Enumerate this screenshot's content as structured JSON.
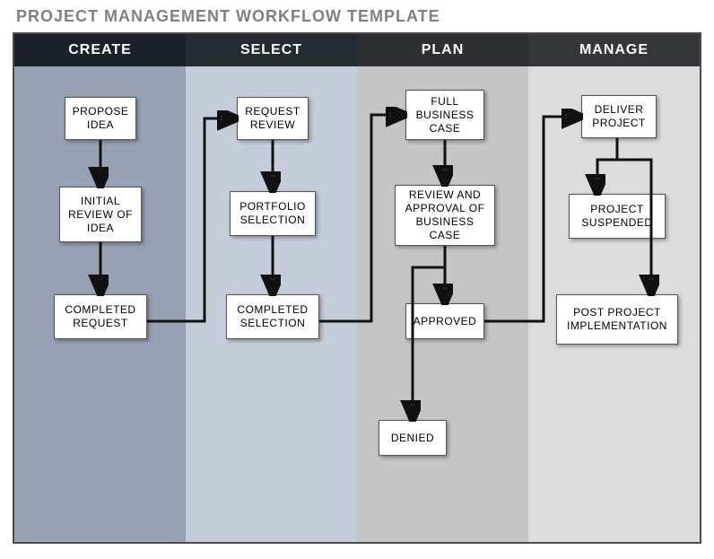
{
  "title": "PROJECT MANAGEMENT WORKFLOW TEMPLATE",
  "columns": [
    {
      "header": "CREATE"
    },
    {
      "header": "SELECT"
    },
    {
      "header": "PLAN"
    },
    {
      "header": "MANAGE"
    }
  ],
  "nodes": {
    "propose_idea": "PROPOSE IDEA",
    "initial_review": "INITIAL REVIEW OF IDEA",
    "completed_request": "COMPLETED REQUEST",
    "request_review": "REQUEST REVIEW",
    "portfolio_selection": "PORTFOLIO SELECTION",
    "completed_selection": "COMPLETED SELECTION",
    "full_business_case": "FULL BUSINESS CASE",
    "review_approval": "REVIEW AND APPROVAL OF BUSINESS CASE",
    "approved": "APPROVED",
    "denied": "DENIED",
    "deliver_project": "DELIVER PROJECT",
    "project_suspended": "PROJECT SUSPENDED",
    "post_project_impl": "POST PROJECT IMPLEMENTATION"
  }
}
